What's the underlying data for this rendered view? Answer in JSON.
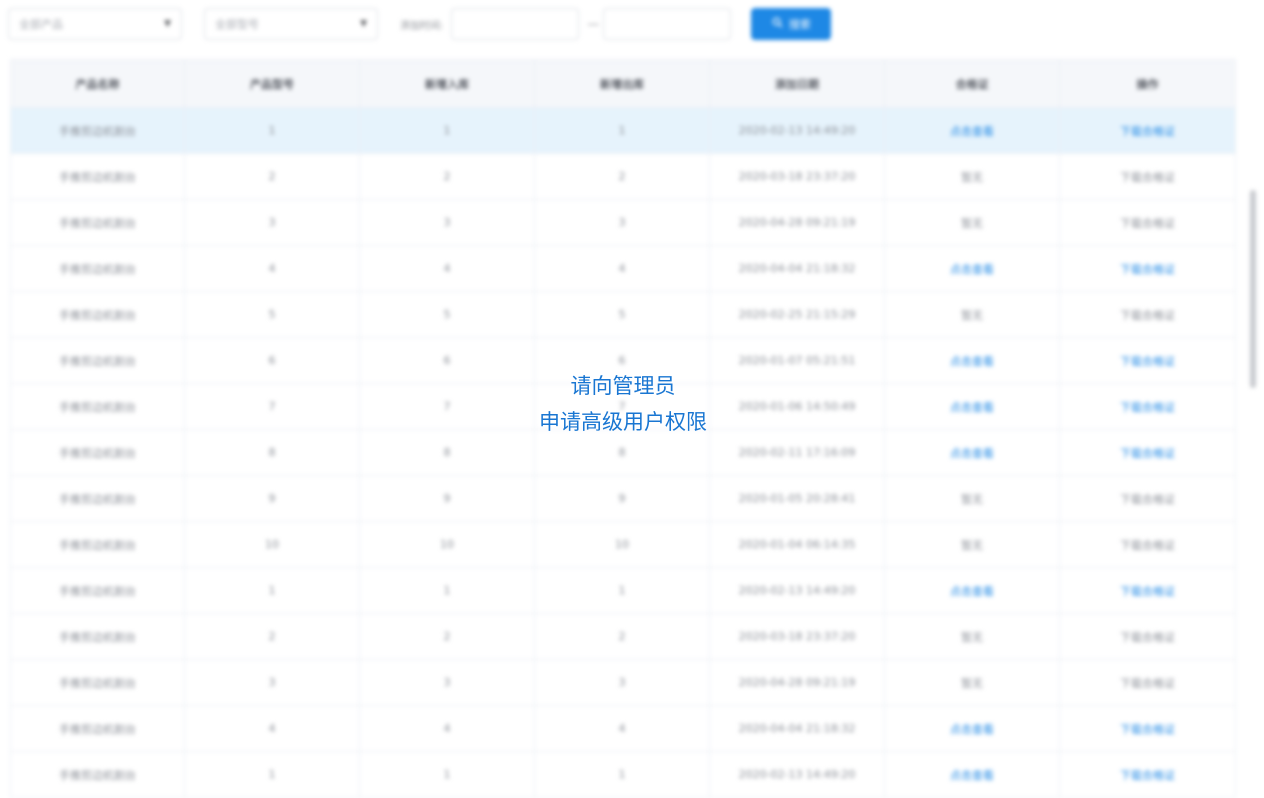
{
  "overlay": {
    "line1": "请向管理员",
    "line2": "申请高级用户权限"
  },
  "filters": {
    "product_placeholder": "全部产品",
    "model_placeholder": "全部型号",
    "date_label": "添加时间:",
    "date_separator": "—",
    "search_label": "搜索",
    "caret_icon": "chevron-down-icon",
    "search_icon": "search-icon"
  },
  "colors": {
    "accent": "#1e88e5",
    "overlay_text": "#1976d2",
    "highlight_row": "#e6f3fc"
  },
  "table": {
    "headers": [
      "产品名称",
      "产品型号",
      "新增入库",
      "新增出库",
      "添加日期",
      "合格证",
      "操作"
    ],
    "rows": [
      {
        "name": "手推剪边机割台",
        "model": "1",
        "in": "1",
        "out": "1",
        "date": "2020-02-13 14:49:20",
        "cert": "点击查看",
        "op": "下载合格证",
        "linked": true
      },
      {
        "name": "手推剪边机割台",
        "model": "2",
        "in": "2",
        "out": "2",
        "date": "2020-03-18 23:37:20",
        "cert": "暂无",
        "op": "下载合格证",
        "linked": false
      },
      {
        "name": "手推剪边机割台",
        "model": "3",
        "in": "3",
        "out": "3",
        "date": "2020-04-28 09:21:19",
        "cert": "暂无",
        "op": "下载合格证",
        "linked": false
      },
      {
        "name": "手推剪边机割台",
        "model": "4",
        "in": "4",
        "out": "4",
        "date": "2020-04-04 21:18:32",
        "cert": "点击查看",
        "op": "下载合格证",
        "linked": true
      },
      {
        "name": "手推剪边机割台",
        "model": "5",
        "in": "5",
        "out": "5",
        "date": "2020-02-25 21:15:29",
        "cert": "暂无",
        "op": "下载合格证",
        "linked": false
      },
      {
        "name": "手推剪边机割台",
        "model": "6",
        "in": "6",
        "out": "6",
        "date": "2020-01-07 05:21:51",
        "cert": "点击查看",
        "op": "下载合格证",
        "linked": true
      },
      {
        "name": "手推剪边机割台",
        "model": "7",
        "in": "7",
        "out": "7",
        "date": "2020-01-06 14:50:49",
        "cert": "点击查看",
        "op": "下载合格证",
        "linked": true
      },
      {
        "name": "手推剪边机割台",
        "model": "8",
        "in": "8",
        "out": "8",
        "date": "2020-02-11 17:16:09",
        "cert": "点击查看",
        "op": "下载合格证",
        "linked": true
      },
      {
        "name": "手推剪边机割台",
        "model": "9",
        "in": "9",
        "out": "9",
        "date": "2020-01-05 20:28:41",
        "cert": "暂无",
        "op": "下载合格证",
        "linked": false
      },
      {
        "name": "手推剪边机割台",
        "model": "10",
        "in": "10",
        "out": "10",
        "date": "2020-01-04 06:14:35",
        "cert": "暂无",
        "op": "下载合格证",
        "linked": false
      },
      {
        "name": "手推剪边机割台",
        "model": "1",
        "in": "1",
        "out": "1",
        "date": "2020-02-13 14:49:20",
        "cert": "点击查看",
        "op": "下载合格证",
        "linked": true
      },
      {
        "name": "手推剪边机割台",
        "model": "2",
        "in": "2",
        "out": "2",
        "date": "2020-03-18 23:37:20",
        "cert": "暂无",
        "op": "下载合格证",
        "linked": false
      },
      {
        "name": "手推剪边机割台",
        "model": "3",
        "in": "3",
        "out": "3",
        "date": "2020-04-28 09:21:19",
        "cert": "暂无",
        "op": "下载合格证",
        "linked": false
      },
      {
        "name": "手推剪边机割台",
        "model": "4",
        "in": "4",
        "out": "4",
        "date": "2020-04-04 21:18:32",
        "cert": "点击查看",
        "op": "下载合格证",
        "linked": true
      },
      {
        "name": "手推剪边机割台",
        "model": "1",
        "in": "1",
        "out": "1",
        "date": "2020-02-13 14:49:20",
        "cert": "点击查看",
        "op": "下载合格证",
        "linked": true
      }
    ]
  }
}
